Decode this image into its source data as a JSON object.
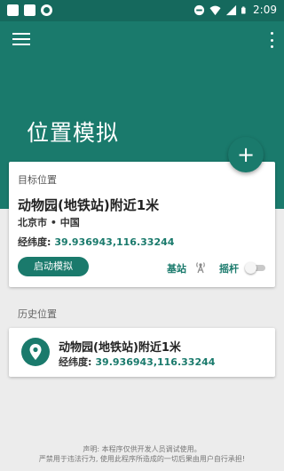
{
  "status_bar": {
    "time": "2:09",
    "icons": [
      "image-icon",
      "app-icon",
      "sync-icon",
      "minus-circle-icon",
      "wifi-icon",
      "signal-icon",
      "battery-icon"
    ]
  },
  "app_bar": {
    "title": "位置模拟",
    "menu_icon": "menu-icon",
    "more_icon": "more-vert-icon"
  },
  "fab": {
    "label": "+"
  },
  "target": {
    "caption": "目标位置",
    "name": "动物园(地铁站)附近1米",
    "region": "北京市 • 中国",
    "coord_label": "经纬度:",
    "coord_value": "39.936943,116.33244",
    "start_button": "启动模拟",
    "base_station_label": "基站",
    "joystick_label": "摇杆",
    "joystick_enabled": false
  },
  "history": {
    "title": "历史位置",
    "items": [
      {
        "name": "动物园(地铁站)附近1米",
        "coord_label": "经纬度:",
        "coord_value": "39.936943,116.33244"
      }
    ]
  },
  "footer": {
    "line1": "声明: 本程序仅供开发人员调试使用。",
    "line2": "严禁用于违法行为, 使用此程序所造成的一切后果由用户自行承担!"
  },
  "colors": {
    "primary": "#1a7a6c",
    "status_bar": "#15695d",
    "background": "#ececec"
  }
}
